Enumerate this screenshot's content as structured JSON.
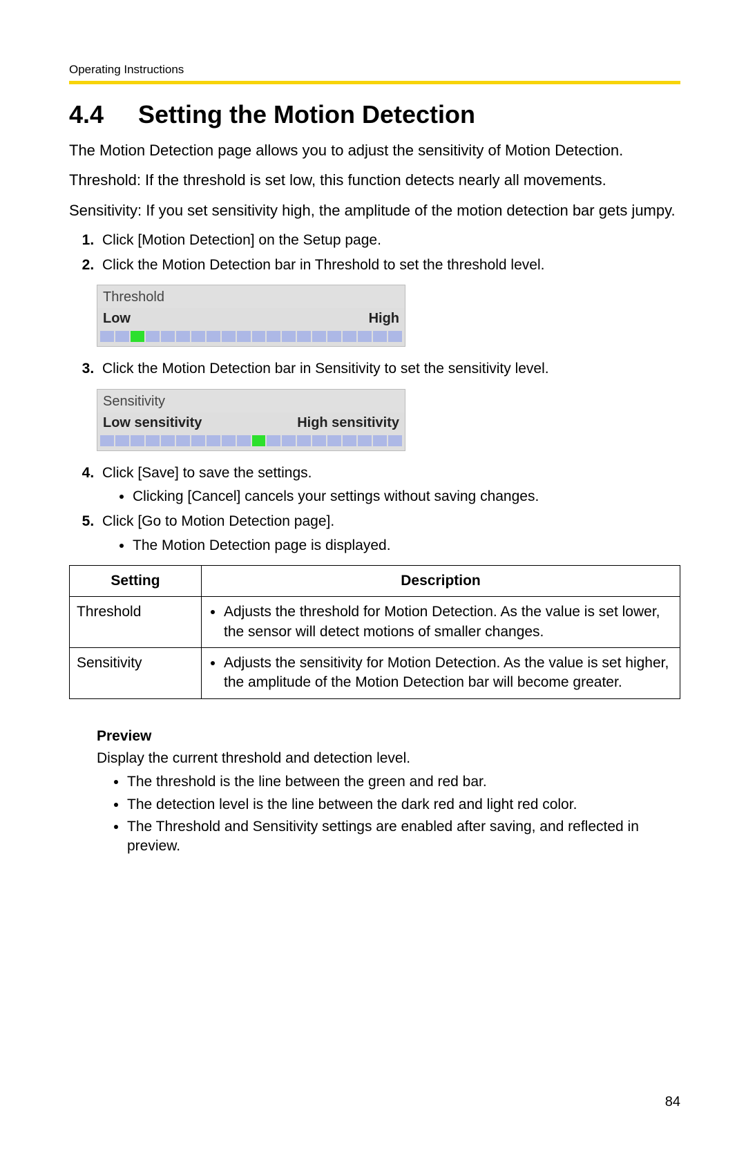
{
  "header": "Operating Instructions",
  "section_number": "4.4",
  "section_title": "Setting the Motion Detection",
  "intro": [
    "The Motion Detection page allows you to adjust the sensitivity of Motion Detection.",
    "Threshold: If the threshold is set low, this function detects nearly all movements.",
    "Sensitivity: If you set sensitivity high, the amplitude of the motion detection bar gets jumpy."
  ],
  "steps": {
    "s1": "Click [Motion Detection] on the Setup page.",
    "s2": "Click the Motion Detection bar in Threshold to set the threshold level.",
    "s3": "Click the Motion Detection bar in Sensitivity to set the sensitivity level.",
    "s4": "Click [Save] to save the settings.",
    "s4_sub": "Clicking [Cancel] cancels your settings without saving changes.",
    "s5": "Click [Go to Motion Detection page].",
    "s5_sub": "The Motion Detection page is displayed."
  },
  "threshold_widget": {
    "title": "Threshold",
    "low": "Low",
    "high": "High",
    "active_index": 2,
    "segments": 20
  },
  "sensitivity_widget": {
    "title": "Sensitivity",
    "low": "Low sensitivity",
    "high": "High sensitivity",
    "active_index": 10,
    "segments": 20
  },
  "table": {
    "headers": {
      "setting": "Setting",
      "description": "Description"
    },
    "rows": [
      {
        "setting": "Threshold",
        "description": "Adjusts the threshold for Motion Detection. As the value is set lower, the sensor will detect motions of smaller changes."
      },
      {
        "setting": "Sensitivity",
        "description": "Adjusts the sensitivity for Motion Detection. As the value is set higher, the amplitude of the Motion Detection bar will become greater."
      }
    ]
  },
  "preview": {
    "heading": "Preview",
    "text": "Display the current threshold and detection level.",
    "bullets": [
      "The threshold is the line between the green and red bar.",
      "The detection level is the line between the dark red and light red color.",
      "The Threshold and Sensitivity settings are enabled after saving, and reflected in preview."
    ]
  },
  "page_number": "84"
}
